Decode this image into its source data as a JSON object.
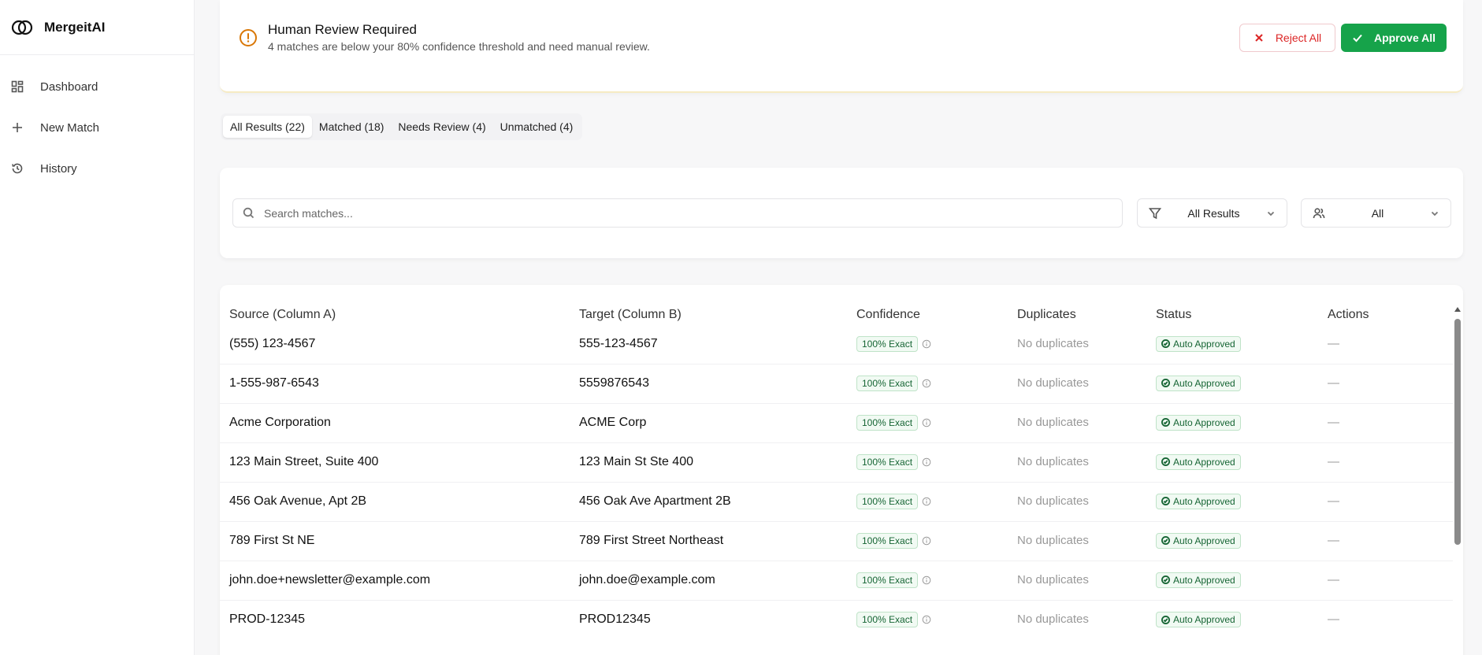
{
  "app": {
    "name": "MergeitAI"
  },
  "sidebar": {
    "items": [
      {
        "label": "Dashboard",
        "icon": "dashboard-icon"
      },
      {
        "label": "New Match",
        "icon": "plus-icon"
      },
      {
        "label": "History",
        "icon": "history-icon"
      }
    ]
  },
  "review": {
    "title": "Human Review Required",
    "description": "4 matches are below your 80% confidence threshold and need manual review.",
    "reject_label": "Reject All",
    "approve_label": "Approve All"
  },
  "tabs": [
    {
      "label": "All Results (22)",
      "active": true
    },
    {
      "label": "Matched (18)",
      "active": false
    },
    {
      "label": "Needs Review (4)",
      "active": false
    },
    {
      "label": "Unmatched (4)",
      "active": false
    }
  ],
  "filters": {
    "search_placeholder": "Search matches...",
    "result_filter": "All Results",
    "user_filter": "All"
  },
  "table": {
    "columns": [
      "Source (Column A)",
      "Target (Column B)",
      "Confidence",
      "Duplicates",
      "Status",
      "Actions"
    ],
    "rows": [
      {
        "source": "(555) 123-4567",
        "target": "555-123-4567",
        "confidence": "100% Exact",
        "duplicates": "No duplicates",
        "status": "Auto Approved",
        "action": "—"
      },
      {
        "source": "1-555-987-6543",
        "target": "5559876543",
        "confidence": "100% Exact",
        "duplicates": "No duplicates",
        "status": "Auto Approved",
        "action": "—"
      },
      {
        "source": "Acme Corporation",
        "target": "ACME Corp",
        "confidence": "100% Exact",
        "duplicates": "No duplicates",
        "status": "Auto Approved",
        "action": "—"
      },
      {
        "source": "123 Main Street, Suite 400",
        "target": "123 Main St Ste 400",
        "confidence": "100% Exact",
        "duplicates": "No duplicates",
        "status": "Auto Approved",
        "action": "—"
      },
      {
        "source": "456 Oak Avenue, Apt 2B",
        "target": "456 Oak Ave Apartment 2B",
        "confidence": "100% Exact",
        "duplicates": "No duplicates",
        "status": "Auto Approved",
        "action": "—"
      },
      {
        "source": "789 First St NE",
        "target": "789 First Street Northeast",
        "confidence": "100% Exact",
        "duplicates": "No duplicates",
        "status": "Auto Approved",
        "action": "—"
      },
      {
        "source": "john.doe+newsletter@example.com",
        "target": "john.doe@example.com",
        "confidence": "100% Exact",
        "duplicates": "No duplicates",
        "status": "Auto Approved",
        "action": "—"
      },
      {
        "source": "PROD-12345",
        "target": "PROD12345",
        "confidence": "100% Exact",
        "duplicates": "No duplicates",
        "status": "Auto Approved",
        "action": "—"
      }
    ]
  },
  "colors": {
    "accent_green": "#16a34a",
    "reject_red": "#dc2626",
    "warning_amber": "#d97706"
  }
}
